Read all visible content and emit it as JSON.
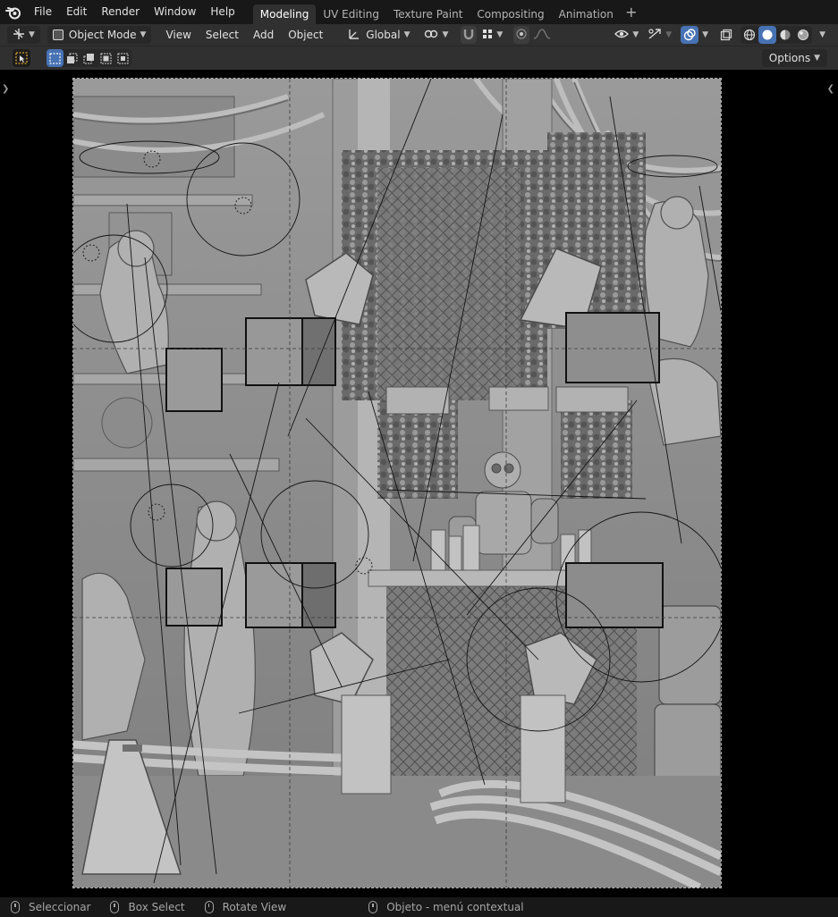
{
  "menubar": {
    "items": [
      "File",
      "Edit",
      "Render",
      "Window",
      "Help"
    ]
  },
  "workspaces": {
    "tabs": [
      "Modeling",
      "UV Editing",
      "Texture Paint",
      "Compositing",
      "Animation"
    ],
    "active": "Modeling",
    "add_icon": "plus-icon"
  },
  "viewport_header": {
    "mode": "Object Mode",
    "menus": [
      "View",
      "Select",
      "Add",
      "Object"
    ],
    "transform_orientation": "Global",
    "accent": "#4772b3"
  },
  "tool_settings": {
    "options_label": "Options"
  },
  "statusbar": {
    "hints": [
      "Seleccionar",
      "Box Select",
      "Rotate View",
      "Objeto - menú contextual"
    ]
  }
}
